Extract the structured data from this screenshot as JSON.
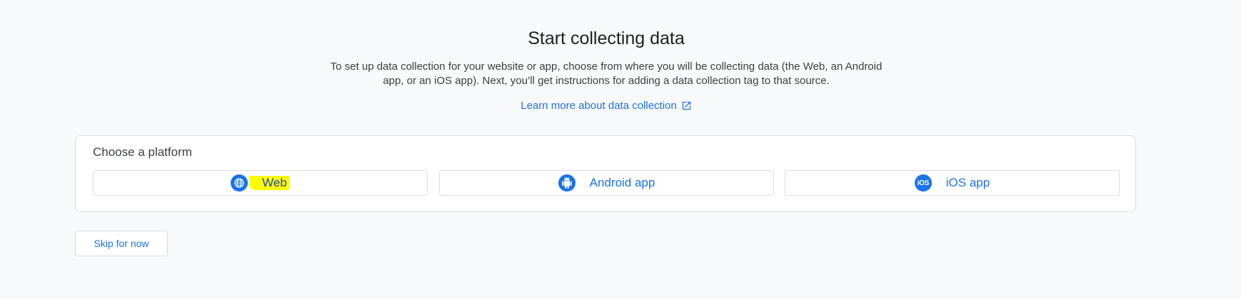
{
  "header": {
    "title": "Start collecting data",
    "description": "To set up data collection for your website or app, choose from where you will be collecting data (the Web, an Android app, or an iOS app). Next, you’ll get instructions for adding a data collection tag to that source.",
    "learn_more_link": "Learn more about data collection",
    "learn_more_icon": "open-in-new-icon"
  },
  "platform_card": {
    "title": "Choose a platform",
    "options": [
      {
        "label": "Web",
        "icon": "globe-icon",
        "highlighted": true
      },
      {
        "label": "Android app",
        "icon": "android-icon"
      },
      {
        "label": "iOS app",
        "icon": "ios-icon",
        "icon_text": "iOS"
      }
    ]
  },
  "skip_button": "Skip for now",
  "colors": {
    "accent": "#1a73e8",
    "background": "#f8f9fa",
    "highlight": "#ffff00",
    "border": "#dadce0"
  }
}
